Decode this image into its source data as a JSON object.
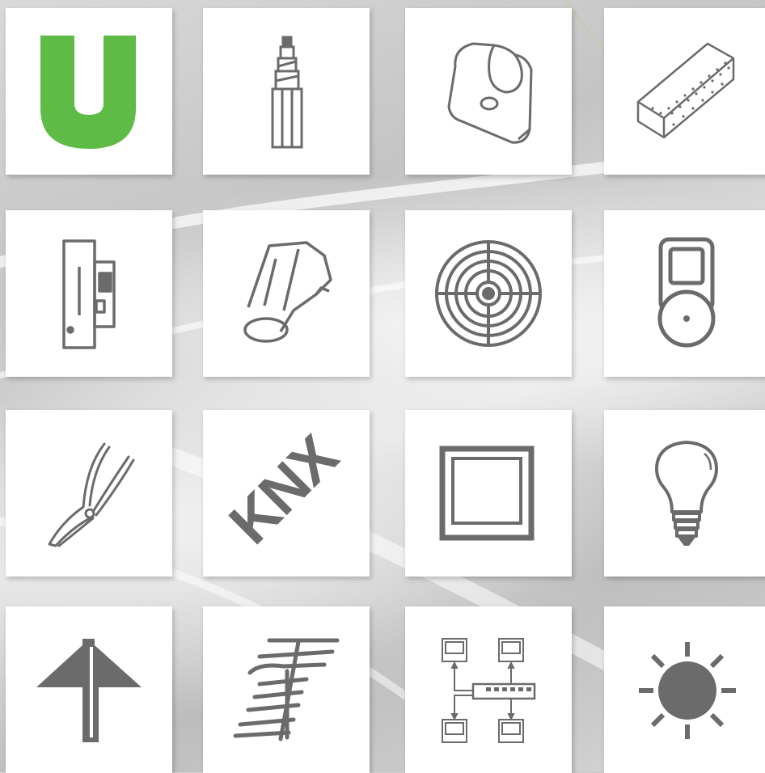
{
  "tiles": [
    {
      "id": "u-logo",
      "icon": "u-logo-icon"
    },
    {
      "id": "cable",
      "icon": "cable-icon"
    },
    {
      "id": "pipe-clip",
      "icon": "pipe-clip-icon"
    },
    {
      "id": "cable-tray",
      "icon": "cable-tray-icon"
    },
    {
      "id": "circuit-breaker",
      "icon": "circuit-breaker-icon"
    },
    {
      "id": "industrial-plug",
      "icon": "industrial-plug-icon"
    },
    {
      "id": "fan",
      "icon": "fan-icon"
    },
    {
      "id": "bell",
      "icon": "bell-icon"
    },
    {
      "id": "pliers",
      "icon": "pliers-icon"
    },
    {
      "id": "knx",
      "icon": "knx-icon",
      "text": "KNX"
    },
    {
      "id": "switch-frame",
      "icon": "switch-frame-icon"
    },
    {
      "id": "light-bulb",
      "icon": "light-bulb-icon"
    },
    {
      "id": "lightning-rod",
      "icon": "lightning-rod-icon"
    },
    {
      "id": "antenna",
      "icon": "antenna-icon"
    },
    {
      "id": "network",
      "icon": "network-icon"
    },
    {
      "id": "sun",
      "icon": "sun-icon"
    }
  ],
  "colors": {
    "icon": "#6b6b6b",
    "accent": "#5dbb46",
    "tile": "#ffffff"
  }
}
